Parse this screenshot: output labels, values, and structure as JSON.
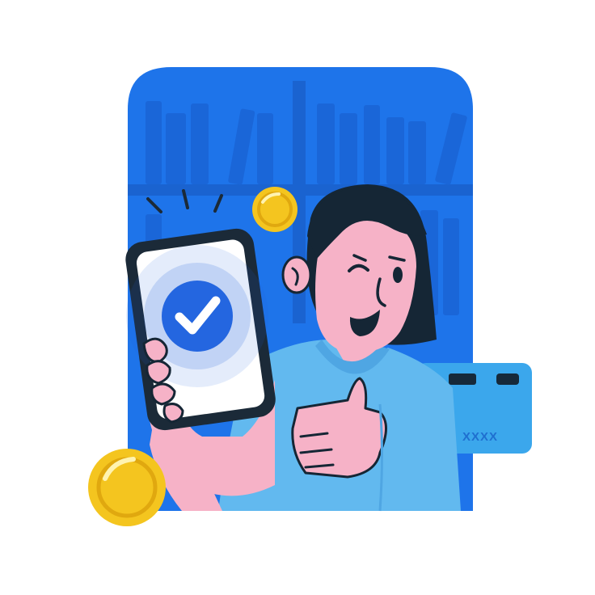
{
  "illustration": {
    "subject": "woman-winking-thumbs-up-with-phone-payment-confirmed",
    "card_number_text": "XXXX"
  },
  "colors": {
    "background": "#ffffff",
    "bookshelf": "#1e74ea",
    "bookshelf_dark": "#1a63d0",
    "card": "#3ba7ec",
    "shirt": "#62b9ef",
    "skin": "#f6b2c7",
    "hair": "#152635",
    "phone_frame": "#1b2a38",
    "check_circle": "#2466e0",
    "coin": "#f4c51f",
    "coin_dark": "#e0a80f"
  },
  "icons": [
    "check-icon",
    "coin-icon",
    "credit-card-icon",
    "smartphone-icon"
  ]
}
